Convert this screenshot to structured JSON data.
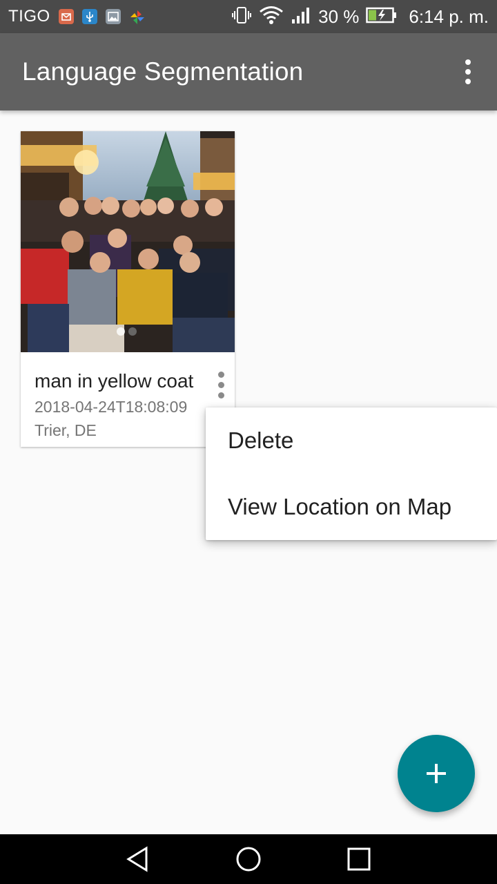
{
  "status_bar": {
    "carrier": "TIGO",
    "battery_percent": "30 %",
    "time": "6:14 p. m.",
    "notification_icons": [
      "mail-icon",
      "usb-icon",
      "gallery-icon",
      "pinwheel-icon"
    ],
    "status_icons": [
      "vibrate-icon",
      "wifi-icon",
      "signal-icon",
      "battery-charging-icon"
    ]
  },
  "app_bar": {
    "title": "Language Segmentation",
    "overflow_icon": "more-vert-icon"
  },
  "cards": [
    {
      "title": "man in yellow coat",
      "date": "2018-04-24T18:08:09",
      "location": "Trier, DE",
      "image": "group photo at christmas market",
      "menu_icon": "more-vert-icon"
    }
  ],
  "popup_menu": {
    "items": [
      {
        "label": "Delete"
      },
      {
        "label": "View Location on Map"
      }
    ]
  },
  "fab": {
    "icon": "add-icon"
  },
  "nav_bar": {
    "icons": [
      "back-icon",
      "home-icon",
      "recents-icon"
    ]
  },
  "colors": {
    "status_bar": "#4a4a4a",
    "app_bar": "#616161",
    "fab": "#00838f",
    "background": "#fafafa"
  }
}
